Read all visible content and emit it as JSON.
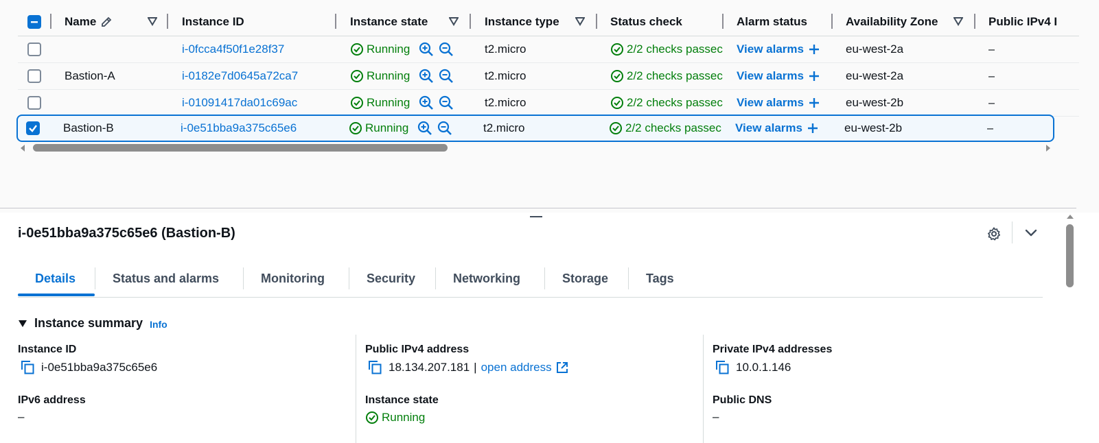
{
  "table": {
    "headers": {
      "name": "Name",
      "instance_id": "Instance ID",
      "instance_state": "Instance state",
      "instance_type": "Instance type",
      "status_check": "Status check",
      "alarm_status": "Alarm status",
      "availability_zone": "Availability Zone",
      "public_ipv4": "Public IPv4 I"
    },
    "rows": [
      {
        "name": "",
        "instance_id": "i-0fcca4f50f1e28f37",
        "state": "Running",
        "type": "t2.micro",
        "status": "2/2 checks passec",
        "alarm": "View alarms",
        "az": "eu-west-2a",
        "ipv4": "–",
        "selected": false
      },
      {
        "name": "Bastion-A",
        "instance_id": "i-0182e7d0645a72ca7",
        "state": "Running",
        "type": "t2.micro",
        "status": "2/2 checks passec",
        "alarm": "View alarms",
        "az": "eu-west-2a",
        "ipv4": "–",
        "selected": false
      },
      {
        "name": "",
        "instance_id": "i-01091417da01c69ac",
        "state": "Running",
        "type": "t2.micro",
        "status": "2/2 checks passec",
        "alarm": "View alarms",
        "az": "eu-west-2b",
        "ipv4": "–",
        "selected": false
      },
      {
        "name": "Bastion-B",
        "instance_id": "i-0e51bba9a375c65e6",
        "state": "Running",
        "type": "t2.micro",
        "status": "2/2 checks passec",
        "alarm": "View alarms",
        "az": "eu-west-2b",
        "ipv4": "–",
        "selected": true
      }
    ]
  },
  "details": {
    "title": "i-0e51bba9a375c65e6 (Bastion-B)",
    "tabs": [
      "Details",
      "Status and alarms",
      "Monitoring",
      "Security",
      "Networking",
      "Storage",
      "Tags"
    ],
    "active_tab": "Details",
    "section_title": "Instance summary",
    "info_link": "Info",
    "fields": {
      "instance_id_label": "Instance ID",
      "instance_id_value": "i-0e51bba9a375c65e6",
      "public_ipv4_label": "Public IPv4 address",
      "public_ipv4_value": "18.134.207.181",
      "public_ipv4_sep": "|",
      "open_address": "open address",
      "private_ipv4_label": "Private IPv4 addresses",
      "private_ipv4_value": "10.0.1.146",
      "ipv6_label": "IPv6 address",
      "ipv6_value": "–",
      "instance_state_label": "Instance state",
      "instance_state_value": "Running",
      "public_dns_label": "Public DNS",
      "public_dns_value": "–"
    }
  },
  "icons": {
    "edit": "pencil-icon",
    "filter": "filter-triangle-icon",
    "success": "check-circle-icon",
    "zoom_in": "zoom-in-icon",
    "zoom_out": "zoom-out-icon",
    "add": "plus-icon",
    "copy": "copy-icon",
    "external": "external-link-icon",
    "settings": "gear-icon",
    "collapse": "chevron-down-icon"
  },
  "colors": {
    "link": "#0972d3",
    "success": "#037f0c",
    "selected_row_bg": "#f2f8fd"
  }
}
